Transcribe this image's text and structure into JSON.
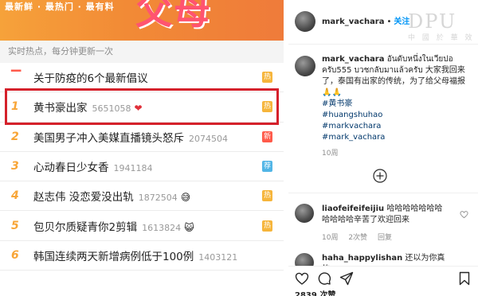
{
  "weibo": {
    "banner_tags": "最新鲜 · 最热门 · 最有料",
    "banner_title": "父母",
    "subheader": "实时热点，每分钟更新一次",
    "items": [
      {
        "rank": "",
        "title": "关于防疫的6个最新倡议",
        "count": "",
        "emoji": "",
        "tag": "热"
      },
      {
        "rank": "1",
        "title": "黄书豪出家",
        "count": "5651058",
        "emoji": "❤",
        "tag": "热"
      },
      {
        "rank": "2",
        "title": "美国男子冲入美媒直播镜头怒斥",
        "count": "2074504",
        "emoji": "",
        "tag": "新"
      },
      {
        "rank": "3",
        "title": "心动春日少女香",
        "count": "1941184",
        "emoji": "",
        "tag": "荐"
      },
      {
        "rank": "4",
        "title": "赵志伟 没恋爱没出轨",
        "count": "1872504",
        "emoji": "😅",
        "tag": "热"
      },
      {
        "rank": "5",
        "title": "包贝尔质疑青你2剪辑",
        "count": "1613824",
        "emoji": "😺",
        "tag": "热"
      },
      {
        "rank": "6",
        "title": "韩国连续两天新增病例低于100例",
        "count": "1403121",
        "emoji": "",
        "tag": ""
      }
    ]
  },
  "instagram": {
    "username": "mark_vachara",
    "dot": "•",
    "follow": "关注",
    "watermark_big": "DPU",
    "watermark_small": "中 國 於 華 效",
    "caption": {
      "username": "mark_vachara",
      "text": "อันดับหนึ่งในเวียปอ ครับ555 บวชกลับมาแล้วครับ 大家我回来了，泰国有出家的传统，为了给父母福报🙏🙏",
      "hashtags": [
        "#黄书豪",
        "#huangshuhao",
        "#markvachara",
        "#mark_vachara"
      ],
      "time": "10周"
    },
    "comments": [
      {
        "username": "liaofeifeifeijiu",
        "text": "哈哈哈哈哈哈哈哈哈哈哈辛苦了欢迎回来",
        "time": "10周",
        "likes": "2次赞",
        "reply": "回复"
      },
      {
        "username": "haha_happylishan",
        "text": "还以为你真的",
        "time": "",
        "likes": "",
        "reply": ""
      }
    ],
    "likes_count": "2839 次赞"
  }
}
